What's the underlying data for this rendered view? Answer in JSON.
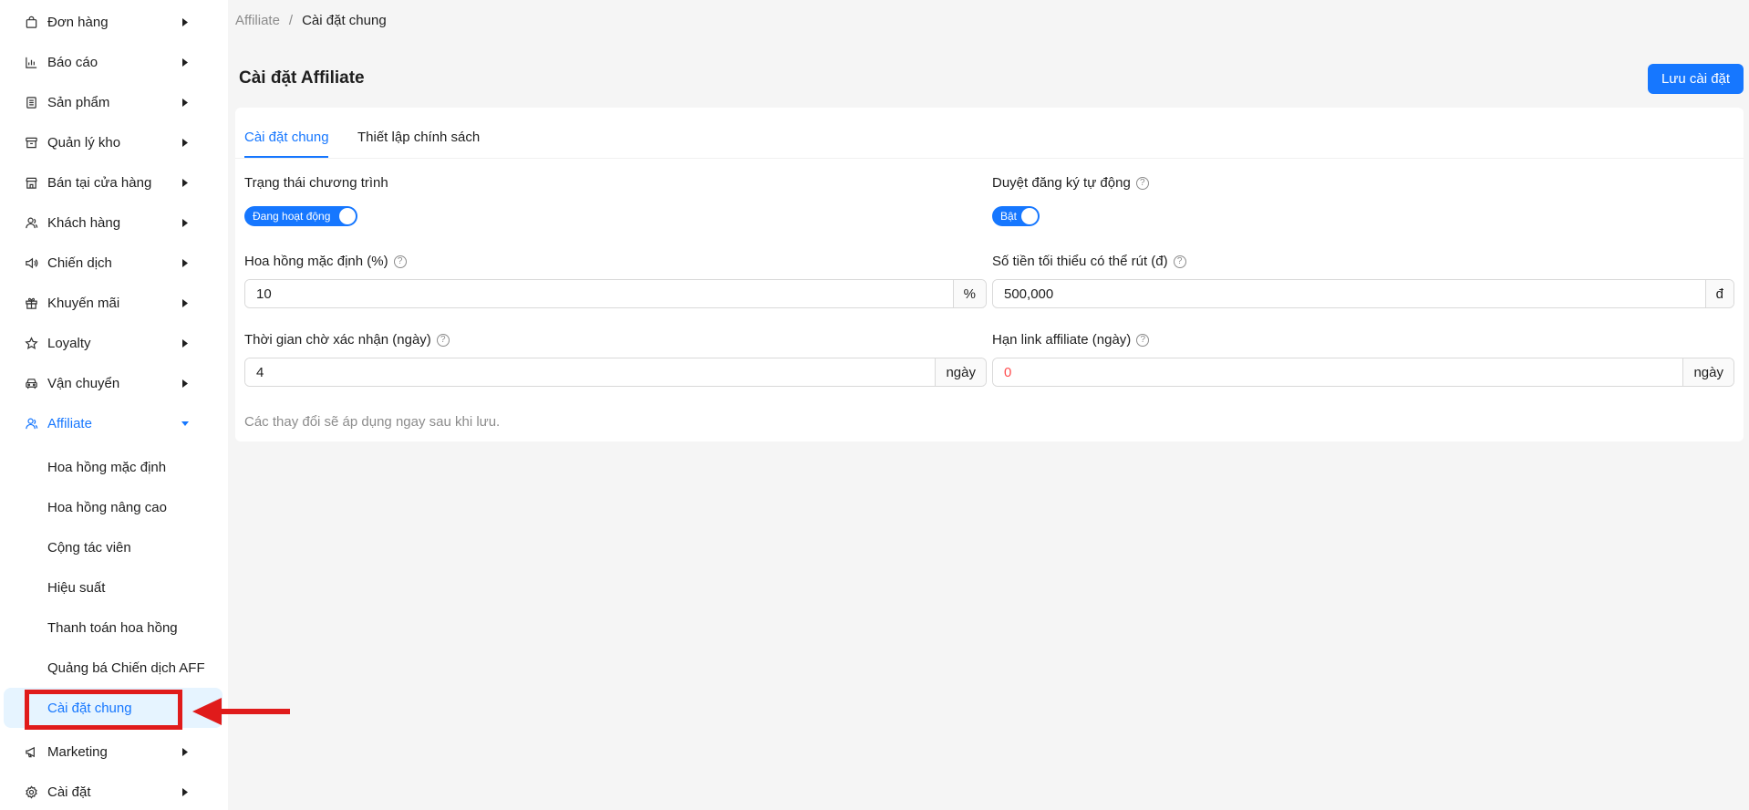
{
  "sidebar": {
    "items": [
      {
        "label": "Đơn hàng",
        "icon": "shopping-bag-icon"
      },
      {
        "label": "Báo cáo",
        "icon": "bar-chart-icon"
      },
      {
        "label": "Sản phẩm",
        "icon": "product-list-icon"
      },
      {
        "label": "Quản lý kho",
        "icon": "archive-box-icon"
      },
      {
        "label": "Bán tại cửa hàng",
        "icon": "store-icon"
      },
      {
        "label": "Khách hàng",
        "icon": "users-icon"
      },
      {
        "label": "Chiến dịch",
        "icon": "sound-icon"
      },
      {
        "label": "Khuyến mãi",
        "icon": "gift-icon"
      },
      {
        "label": "Loyalty",
        "icon": "star-icon"
      },
      {
        "label": "Vận chuyển",
        "icon": "car-icon"
      },
      {
        "label": "Affiliate",
        "icon": "affiliate-users-icon"
      }
    ],
    "affiliate_sub": [
      {
        "label": "Hoa hồng mặc định"
      },
      {
        "label": "Hoa hồng nâng cao"
      },
      {
        "label": "Cộng tác viên"
      },
      {
        "label": "Hiệu suất"
      },
      {
        "label": "Thanh toán hoa hồng"
      },
      {
        "label": "Quảng bá Chiến dịch AFF"
      },
      {
        "label": "Cài đặt chung"
      }
    ],
    "bottom_items": [
      {
        "label": "Marketing",
        "icon": "megaphone-icon"
      },
      {
        "label": "Cài đặt",
        "icon": "gear-icon"
      }
    ]
  },
  "breadcrumb": {
    "parent": "Affiliate",
    "separator": "/",
    "current": "Cài đặt chung"
  },
  "page": {
    "title": "Cài đặt Affiliate",
    "save_label": "Lưu cài đặt"
  },
  "tabs": [
    {
      "label": "Cài đặt chung"
    },
    {
      "label": "Thiết lập chính sách"
    }
  ],
  "form": {
    "program_status": {
      "label": "Trạng thái chương trình",
      "switch_label": "Đang hoạt động",
      "on": true
    },
    "auto_approve": {
      "label": "Duyệt đăng ký tự động",
      "switch_label": "Bật",
      "on": true
    },
    "default_commission": {
      "label": "Hoa hồng mặc định (%)",
      "value": "10",
      "suffix": "%"
    },
    "min_withdraw": {
      "label": "Số tiền tối thiểu có thể rút (đ)",
      "value": "500,000",
      "suffix": "đ"
    },
    "confirm_wait": {
      "label": "Thời gian chờ xác nhận (ngày)",
      "value": "4",
      "suffix": "ngày"
    },
    "link_expiry": {
      "label": "Hạn link affiliate (ngày)",
      "value": "0",
      "suffix": "ngày"
    },
    "hint": "Các thay đổi sẽ áp dụng ngay sau khi lưu."
  },
  "colors": {
    "accent": "#1677ff",
    "annotation": "#e01b1b",
    "selected_bg": "#e6f4ff",
    "error_text": "#ff4d4f"
  }
}
